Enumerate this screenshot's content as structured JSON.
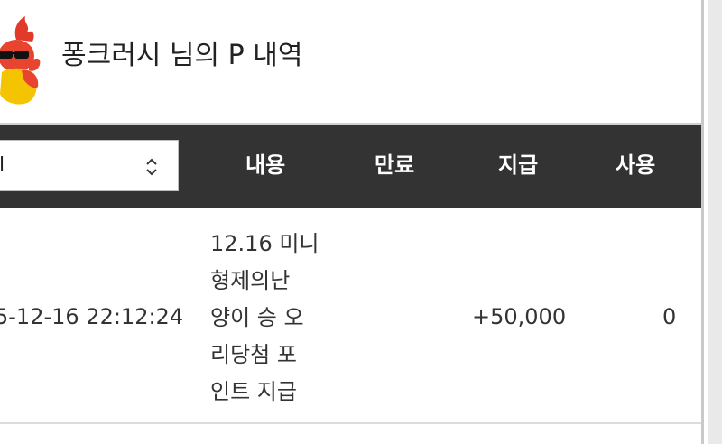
{
  "header": {
    "title": "퐁크러시 님의 P 내역",
    "mascot": "mascot-icon"
  },
  "table": {
    "filter_select": {
      "value": "l"
    },
    "columns": [
      "내용",
      "만료",
      "지급",
      "사용"
    ],
    "rows": [
      {
        "date": "5-12-16 22:12:24",
        "content_lines": [
          "12.16 미니",
          "형제의난",
          "양이 승 오",
          "리당첨 포",
          "인트 지급"
        ],
        "expire": "",
        "grant": "+50,000",
        "use": "0"
      }
    ]
  },
  "colors": {
    "header_bg": "#333333",
    "header_text": "#ffffff",
    "text": "#333333",
    "mascot_red": "#e23a2a",
    "mascot_yellow": "#f5c400"
  }
}
